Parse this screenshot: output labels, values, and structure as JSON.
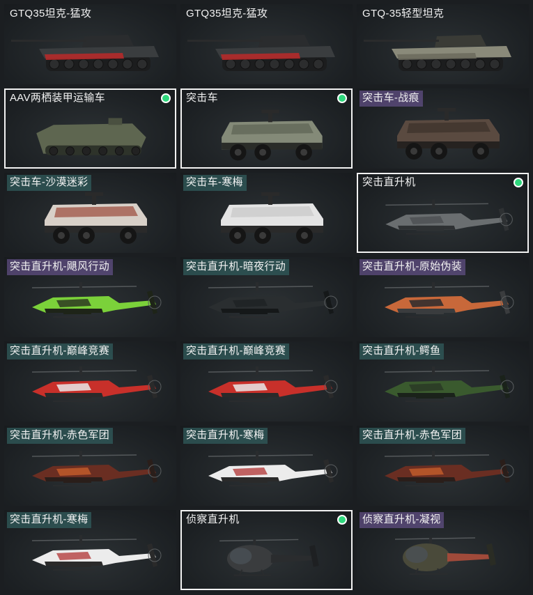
{
  "items": [
    {
      "label": "GTQ35坦克-猛攻",
      "tag": "plain",
      "kind": "tank",
      "colors": [
        "#3a3d3f",
        "#b52a2a",
        "#2a2c2e"
      ],
      "selected": false,
      "dot": false
    },
    {
      "label": "GTQ35坦克-猛攻",
      "tag": "plain",
      "kind": "tank",
      "colors": [
        "#3a3d3f",
        "#b52a2a",
        "#2a2c2e"
      ],
      "selected": false,
      "dot": false
    },
    {
      "label": "GTQ-35轻型坦克",
      "tag": "plain",
      "kind": "tank",
      "colors": [
        "#8a8a7a",
        "#6d6c5e",
        "#3a3b36"
      ],
      "selected": false,
      "dot": false
    },
    {
      "label": "AAV两栖装甲运输车",
      "tag": "plain",
      "kind": "apc",
      "colors": [
        "#5e6650",
        "#4a5040",
        "#2e332a"
      ],
      "selected": true,
      "dot": true
    },
    {
      "label": "突击车",
      "tag": "plain",
      "kind": "truck",
      "colors": [
        "#848a78",
        "#5d6253",
        "#2a2c28"
      ],
      "selected": true,
      "dot": true
    },
    {
      "label": "突击车-战痕",
      "tag": "purple",
      "kind": "truck",
      "colors": [
        "#5a4a40",
        "#3a302a",
        "#262220"
      ],
      "selected": false,
      "dot": false
    },
    {
      "label": "突击车-沙漠迷彩",
      "tag": "teal",
      "kind": "truck",
      "colors": [
        "#d8d0c8",
        "#9b4a3a",
        "#2a2a2a"
      ],
      "selected": false,
      "dot": false
    },
    {
      "label": "突击车-寒梅",
      "tag": "teal",
      "kind": "truck",
      "colors": [
        "#e4e4e4",
        "#c8c8c8",
        "#2a2a2a"
      ],
      "selected": false,
      "dot": false
    },
    {
      "label": "突击直升机",
      "tag": "plain",
      "kind": "heli",
      "colors": [
        "#6a6e70",
        "#4d5153",
        "#2e3133"
      ],
      "selected": true,
      "dot": true
    },
    {
      "label": "突击直升机-飓风行动",
      "tag": "purple",
      "kind": "heli",
      "colors": [
        "#7bd13a",
        "#2e3a22",
        "#1e2418"
      ],
      "selected": false,
      "dot": false
    },
    {
      "label": "突击直升机-暗夜行动",
      "tag": "teal",
      "kind": "heli",
      "colors": [
        "#2a2e30",
        "#1e2224",
        "#151819"
      ],
      "selected": false,
      "dot": false
    },
    {
      "label": "突击直升机-原始伪装",
      "tag": "purple",
      "kind": "heli",
      "colors": [
        "#c8683a",
        "#2a2c2e",
        "#3a3c3e"
      ],
      "selected": false,
      "dot": false
    },
    {
      "label": "突击直升机-巅峰竞赛",
      "tag": "teal",
      "kind": "heli",
      "colors": [
        "#c8302a",
        "#e8e8e8",
        "#2a2a2a"
      ],
      "selected": false,
      "dot": false
    },
    {
      "label": "突击直升机-巅峰竞赛",
      "tag": "teal",
      "kind": "heli",
      "colors": [
        "#c8302a",
        "#e8e8e8",
        "#2a2a2a"
      ],
      "selected": false,
      "dot": false
    },
    {
      "label": "突击直升机-鳄鱼",
      "tag": "teal",
      "kind": "heli",
      "colors": [
        "#3a5a2e",
        "#2a3a24",
        "#1a221a"
      ],
      "selected": false,
      "dot": false
    },
    {
      "label": "突击直升机-赤色军团",
      "tag": "teal",
      "kind": "heli",
      "colors": [
        "#6a2e22",
        "#c05a2a",
        "#2a1e1a"
      ],
      "selected": false,
      "dot": false
    },
    {
      "label": "突击直升机-寒梅",
      "tag": "teal",
      "kind": "heli",
      "colors": [
        "#ececec",
        "#b84a4a",
        "#2a2a2a"
      ],
      "selected": false,
      "dot": false
    },
    {
      "label": "突击直升机-赤色军团",
      "tag": "teal",
      "kind": "heli",
      "colors": [
        "#6a2e22",
        "#c05a2a",
        "#2a1e1a"
      ],
      "selected": false,
      "dot": false
    },
    {
      "label": "突击直升机-寒梅",
      "tag": "teal",
      "kind": "heli",
      "colors": [
        "#ececec",
        "#b84a4a",
        "#2a2a2a"
      ],
      "selected": false,
      "dot": false
    },
    {
      "label": "侦察直升机",
      "tag": "plain",
      "kind": "scout",
      "colors": [
        "#3a3c3e",
        "#2a2c2e",
        "#1e2022"
      ],
      "selected": true,
      "dot": true
    },
    {
      "label": "侦察直升机-凝视",
      "tag": "purple",
      "kind": "scout",
      "colors": [
        "#4a4a3a",
        "#a04a3a",
        "#2a2c24"
      ],
      "selected": false,
      "dot": false
    }
  ]
}
